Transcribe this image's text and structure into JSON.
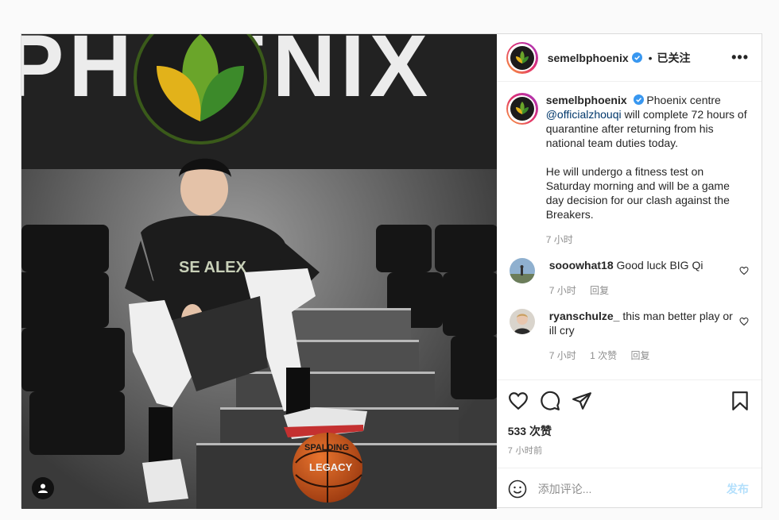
{
  "header": {
    "username": "semelbphoenix",
    "separator": "•",
    "follow_state": "已关注",
    "more_label": "•••"
  },
  "caption": {
    "username": "semelbphoenix",
    "text_before": "Phoenix centre",
    "mention": "@officialzhouqi",
    "text_after": "will complete 72 hours of quarantine after returning from his national team duties today.",
    "paragraph2": "He will undergo a fitness test on Saturday morning and will be a game day decision for our clash against the Breakers.",
    "time": "7 小时"
  },
  "comments": [
    {
      "username": "sooowhat18",
      "text": "Good luck BIG Qi",
      "time": "7 小时",
      "reply": "回复",
      "likes": ""
    },
    {
      "username": "ryanschulze_",
      "text": "this man better play or ill cry",
      "time": "7 小时",
      "likes": "1 次赞",
      "reply": "回复"
    }
  ],
  "actions": {
    "likes_count": "533 次赞",
    "post_time": "7 小时前"
  },
  "add_comment": {
    "placeholder": "添加评论...",
    "post_label": "发布"
  },
  "image": {
    "wall_text": "PHOENIX",
    "ball_brand": "SPALDING",
    "ball_model": "LEGACY",
    "shirt_text": "SE ALEX"
  },
  "icons": [
    "user-tag-icon",
    "verified-icon",
    "more-icon",
    "heart-icon",
    "comment-icon",
    "share-icon",
    "save-icon",
    "emoji-icon"
  ]
}
